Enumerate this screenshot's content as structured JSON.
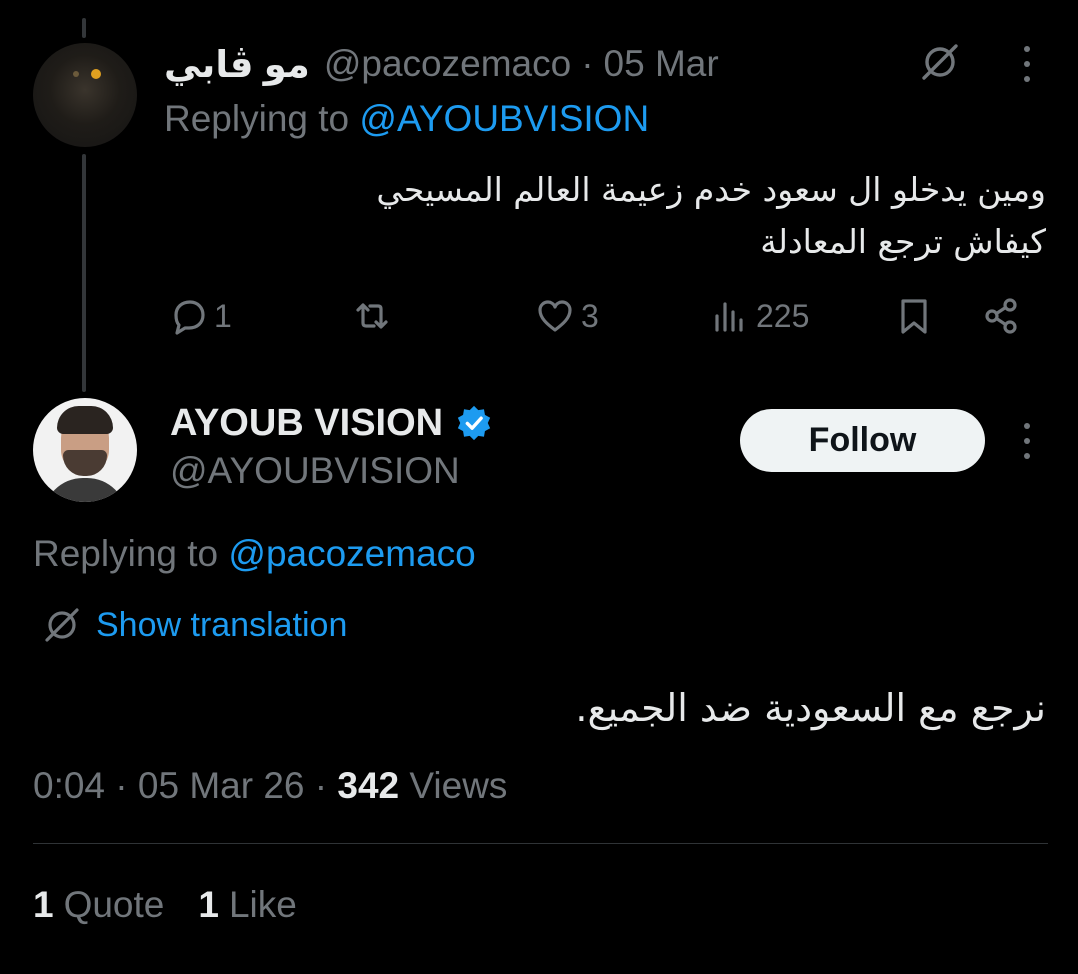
{
  "reply_tweet": {
    "display_name": "مو ڤابي",
    "handle": "@pacozemaco",
    "separator": "·",
    "date": "05 Mar",
    "replying_prefix": "Replying to",
    "replying_to": "@AYOUBVISION",
    "text_line1": "ومين يدخلو ال سعود خدم زعيمة العالم المسيحي",
    "text_line2": "كيفاش ترجع المعادلة",
    "actions": {
      "replies": "1",
      "retweets": "",
      "likes": "3",
      "views": "225"
    }
  },
  "main_tweet": {
    "display_name": "AYOUB VISION",
    "handle": "@AYOUBVISION",
    "follow_label": "Follow",
    "replying_prefix": "Replying to",
    "replying_to": "@pacozemaco",
    "show_translation": "Show translation",
    "text": "نرجع مع السعودية ضد الجميع.",
    "time": "0:04",
    "date": "05 Mar 26",
    "separator": "·",
    "views_count": "342",
    "views_label": "Views",
    "quotes_count": "1",
    "quotes_label": "Quote",
    "likes_count": "1",
    "likes_label": "Like"
  },
  "icons": {
    "reply": "reply-icon",
    "retweet": "retweet-icon",
    "like": "heart-icon",
    "views": "views-icon",
    "bookmark": "bookmark-icon",
    "share": "share-icon",
    "more": "more-icon",
    "translate": "globe-slash-icon",
    "verified": "verified-badge-icon"
  },
  "colors": {
    "background": "#000000",
    "text": "#e7e9ea",
    "secondary": "#71767b",
    "link": "#1d9bf0",
    "verified": "#1d9bf0",
    "follow_bg": "#eff3f4"
  }
}
